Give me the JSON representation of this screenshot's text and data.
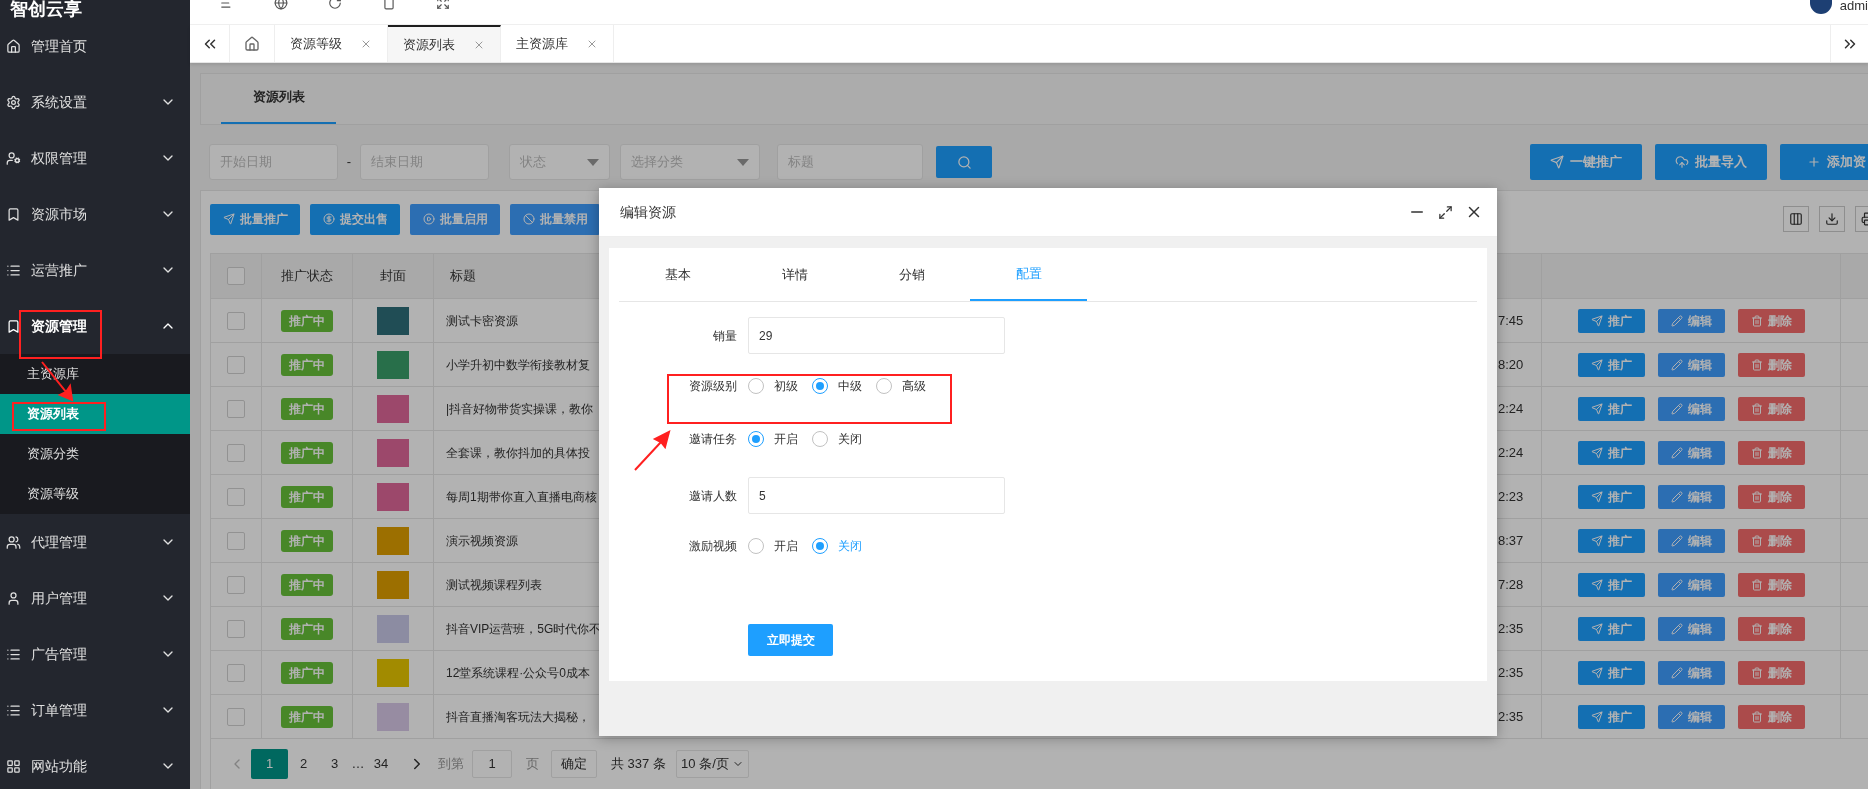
{
  "header": {
    "logo": "智创云享",
    "user": "admi"
  },
  "sidebar": {
    "items": [
      {
        "label": "管理首页",
        "kind": "link",
        "expanded": false
      },
      {
        "label": "系统设置",
        "kind": "menu",
        "expanded": false
      },
      {
        "label": "权限管理",
        "kind": "menu",
        "expanded": false
      },
      {
        "label": "资源市场",
        "kind": "menu",
        "expanded": false
      },
      {
        "label": "运营推广",
        "kind": "menu",
        "expanded": false
      },
      {
        "label": "资源管理",
        "kind": "menu",
        "expanded": true,
        "children": [
          {
            "label": "主资源库",
            "selected": false
          },
          {
            "label": "资源列表",
            "selected": true
          },
          {
            "label": "资源分类",
            "selected": false
          },
          {
            "label": "资源等级",
            "selected": false
          }
        ]
      },
      {
        "label": "代理管理",
        "kind": "menu",
        "expanded": false
      },
      {
        "label": "用户管理",
        "kind": "menu",
        "expanded": false
      },
      {
        "label": "广告管理",
        "kind": "menu",
        "expanded": false
      },
      {
        "label": "订单管理",
        "kind": "menu",
        "expanded": false
      },
      {
        "label": "网站功能",
        "kind": "menu",
        "expanded": false
      }
    ]
  },
  "tabs": [
    {
      "label": "资源等级",
      "selected": false
    },
    {
      "label": "资源列表",
      "selected": true
    },
    {
      "label": "主资源库",
      "selected": false
    }
  ],
  "page": {
    "title": "资源列表",
    "filters": {
      "start_date": "开始日期",
      "range_separator": "-",
      "end_date": "结束日期",
      "status": "状态",
      "category": "选择分类",
      "title": "标题"
    },
    "top_actions": [
      "一键推广",
      "批量导入",
      "添加资"
    ],
    "batch_actions": [
      "批量推广",
      "提交出售",
      "批量启用",
      "批量禁用"
    ]
  },
  "table": {
    "header_checked": false,
    "columns": [
      "推广状态",
      "封面",
      "标题"
    ],
    "rows": [
      {
        "checked": false,
        "status": "推广中",
        "title": "测试卡密资源",
        "time": "7:45",
        "actions": [
          "推广",
          "编辑",
          "删除"
        ]
      },
      {
        "checked": false,
        "status": "推广中",
        "title": "小学升初中数学衔接教材复",
        "time": "8:20",
        "actions": [
          "推广",
          "编辑",
          "删除"
        ]
      },
      {
        "checked": false,
        "status": "推广中",
        "title": "|抖音好物带货实操课，教你",
        "time": "2:24",
        "actions": [
          "推广",
          "编辑",
          "删除"
        ]
      },
      {
        "checked": false,
        "status": "推广中",
        "title": "全套课，教你抖加的具体投",
        "time": "2:24",
        "actions": [
          "推广",
          "编辑",
          "删除"
        ]
      },
      {
        "checked": false,
        "status": "推广中",
        "title": "每周1期带你直入直播电商核",
        "time": "2:23",
        "actions": [
          "推广",
          "编辑",
          "删除"
        ]
      },
      {
        "checked": false,
        "status": "推广中",
        "title": "演示视频资源",
        "time": "8:37",
        "actions": [
          "推广",
          "编辑",
          "删除"
        ]
      },
      {
        "checked": false,
        "status": "推广中",
        "title": "测试视频课程列表",
        "time": "7:28",
        "actions": [
          "推广",
          "编辑",
          "删除"
        ]
      },
      {
        "checked": false,
        "status": "推广中",
        "title": "抖音VIP运营班，5G时代你不",
        "time": "2:35",
        "actions": [
          "推广",
          "编辑",
          "删除"
        ]
      },
      {
        "checked": false,
        "status": "推广中",
        "title": "12堂系统课程·公众号0成本",
        "time": "2:35",
        "actions": [
          "推广",
          "编辑",
          "删除"
        ]
      },
      {
        "checked": false,
        "status": "推广中",
        "title": "抖音直播淘客玩法大揭秘，",
        "time": "2:35",
        "actions": [
          "推广",
          "编辑",
          "删除"
        ]
      }
    ]
  },
  "pagination": {
    "pages": [
      {
        "label": "1",
        "selected": true
      },
      {
        "label": "2",
        "selected": false
      },
      {
        "label": "3",
        "selected": false
      }
    ],
    "ellipsis": "…",
    "last_page": "34",
    "goto_label": "到第",
    "goto_value": "1",
    "goto_suffix": "页",
    "confirm": "确定",
    "total": "共 337 条",
    "page_size": "10 条/页"
  },
  "dialog": {
    "title": "编辑资源",
    "tabs": [
      {
        "label": "基本",
        "selected": false
      },
      {
        "label": "详情",
        "selected": false
      },
      {
        "label": "分销",
        "selected": false
      },
      {
        "label": "配置",
        "selected": true
      }
    ],
    "fields": [
      {
        "kind": "input",
        "label": "销量",
        "value": "29"
      },
      {
        "kind": "radio",
        "label": "资源级别",
        "options": [
          {
            "label": "初级",
            "selected": false,
            "hovered": false
          },
          {
            "label": "中级",
            "selected": true,
            "hovered": false
          },
          {
            "label": "高级",
            "selected": false,
            "hovered": false
          }
        ]
      },
      {
        "kind": "radio",
        "label": "邀请任务",
        "options": [
          {
            "label": "开启",
            "selected": true,
            "hovered": false
          },
          {
            "label": "关闭",
            "selected": false,
            "hovered": false
          }
        ]
      },
      {
        "kind": "input",
        "label": "邀请人数",
        "value": "5"
      },
      {
        "kind": "radio",
        "label": "激励视频",
        "options": [
          {
            "label": "开启",
            "selected": false,
            "hovered": false
          },
          {
            "label": "关闭",
            "selected": true,
            "hovered": true
          }
        ]
      }
    ],
    "submit": "立即提交"
  }
}
